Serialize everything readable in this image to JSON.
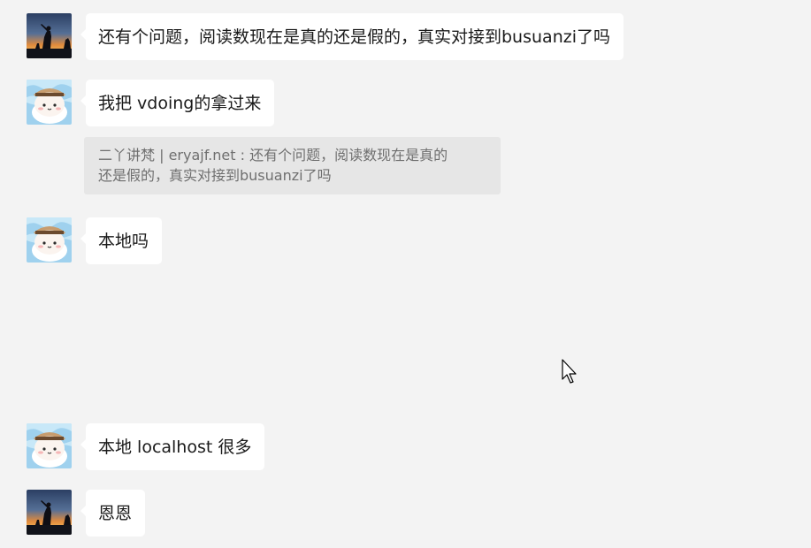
{
  "messages": [
    {
      "sender": "user_a",
      "avatar": "sunset-silhouette-avatar",
      "text": "还有个问题，阅读数现在是真的还是假的，真实对接到busuanzi了吗"
    },
    {
      "sender": "user_b",
      "avatar": "hamster-avatar",
      "text": "我把 vdoing的拿过来"
    },
    {
      "sender": "user_b",
      "avatar": "hamster-avatar",
      "text": "本地吗"
    },
    {
      "sender": "user_b",
      "avatar": "hamster-avatar",
      "text": "本地 localhost 很多"
    },
    {
      "sender": "user_a",
      "avatar": "sunset-silhouette-avatar",
      "text": "恩恩"
    }
  ],
  "quote": {
    "line1": "二丫讲梵 | eryajf.net : 还有个问题，阅读数现在是真的",
    "line2": "还是假的，真实对接到busuanzi了吗"
  },
  "colors": {
    "background": "#f3f3f3",
    "bubble": "#ffffff",
    "quote_background": "#e6e6e6",
    "quote_text": "#6f6f6f"
  }
}
